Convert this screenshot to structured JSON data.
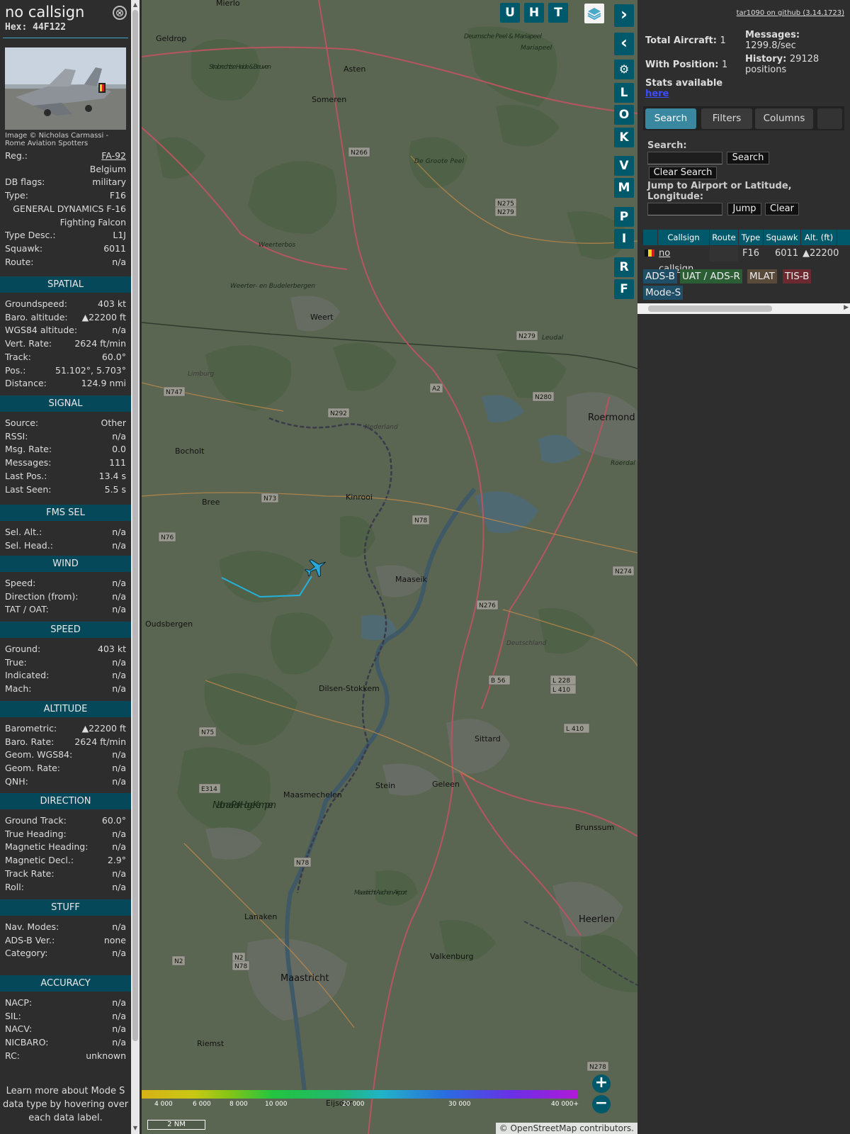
{
  "aircraft": {
    "callsign": "no callsign",
    "hex_label": "Hex:",
    "hex": "44F122",
    "close_glyph": "⊗",
    "photo_credit": "Image © Nicholas Carmassi - Rome Aviation Spotters",
    "header_rows": [
      {
        "label": "Reg.:",
        "value": "FA-92"
      },
      {
        "label": "",
        "value": "Belgium"
      },
      {
        "label": "DB flags:",
        "value": "military"
      },
      {
        "label": "Type:",
        "value": "F16"
      },
      {
        "label": "",
        "value": "GENERAL DYNAMICS F-16"
      },
      {
        "label": "",
        "value": "Fighting Falcon"
      },
      {
        "label": "Type Desc.:",
        "value": "L1J"
      },
      {
        "label": "Squawk:",
        "value": "6011"
      },
      {
        "label": "Route:",
        "value": "n/a"
      }
    ]
  },
  "sections": {
    "spatial": {
      "title": "SPATIAL",
      "rows": [
        {
          "label": "Groundspeed:",
          "value": "403 kt"
        },
        {
          "label": "Baro. altitude:",
          "value": "▲22200 ft"
        },
        {
          "label": "WGS84 altitude:",
          "value": "n/a"
        },
        {
          "label": "Vert. Rate:",
          "value": "2624 ft/min"
        },
        {
          "label": "Track:",
          "value": "60.0°"
        },
        {
          "label": "Pos.:",
          "value": "51.102°, 5.703°"
        },
        {
          "label": "Distance:",
          "value": "124.9 nmi"
        }
      ]
    },
    "signal": {
      "title": "SIGNAL",
      "rows": [
        {
          "label": "Source:",
          "value": "Other"
        },
        {
          "label": "RSSI:",
          "value": "n/a"
        },
        {
          "label": "Msg. Rate:",
          "value": "0.0"
        },
        {
          "label": "Messages:",
          "value": "111"
        },
        {
          "label": "Last Pos.:",
          "value": "13.4 s"
        },
        {
          "label": "Last Seen:",
          "value": "5.5 s"
        }
      ]
    },
    "fms": {
      "title": "FMS SEL",
      "rows": [
        {
          "label": "Sel. Alt.:",
          "value": "n/a"
        },
        {
          "label": "Sel. Head.:",
          "value": "n/a"
        }
      ]
    },
    "wind": {
      "title": "WIND",
      "rows": [
        {
          "label": "Speed:",
          "value": "n/a"
        },
        {
          "label": "Direction (from):",
          "value": "n/a"
        },
        {
          "label": "TAT / OAT:",
          "value": "n/a"
        }
      ]
    },
    "speed": {
      "title": "SPEED",
      "rows": [
        {
          "label": "Ground:",
          "value": "403 kt"
        },
        {
          "label": "True:",
          "value": "n/a"
        },
        {
          "label": "Indicated:",
          "value": "n/a"
        },
        {
          "label": "Mach:",
          "value": "n/a"
        }
      ]
    },
    "altitude": {
      "title": "ALTITUDE",
      "rows": [
        {
          "label": "Barometric:",
          "value": "▲22200 ft"
        },
        {
          "label": "Baro. Rate:",
          "value": "2624 ft/min"
        },
        {
          "label": "Geom. WGS84:",
          "value": "n/a"
        },
        {
          "label": "Geom. Rate:",
          "value": "n/a"
        },
        {
          "label": "QNH:",
          "value": "n/a"
        }
      ]
    },
    "direction": {
      "title": "DIRECTION",
      "rows": [
        {
          "label": "Ground Track:",
          "value": "60.0°"
        },
        {
          "label": "True Heading:",
          "value": "n/a"
        },
        {
          "label": "Magnetic Heading:",
          "value": "n/a"
        },
        {
          "label": "Magnetic Decl.:",
          "value": "2.9°"
        },
        {
          "label": "Track Rate:",
          "value": "n/a"
        },
        {
          "label": "Roll:",
          "value": "n/a"
        }
      ]
    },
    "stuff": {
      "title": "STUFF",
      "rows": [
        {
          "label": "Nav. Modes:",
          "value": "n/a"
        },
        {
          "label": "ADS-B Ver.:",
          "value": "none"
        },
        {
          "label": "Category:",
          "value": "n/a"
        }
      ]
    },
    "accuracy": {
      "title": "ACCURACY",
      "rows": [
        {
          "label": "NACP:",
          "value": "n/a"
        },
        {
          "label": "SIL:",
          "value": "n/a"
        },
        {
          "label": "NACV:",
          "value": "n/a"
        },
        {
          "label": "NICBARO:",
          "value": "n/a"
        },
        {
          "label": "RC:",
          "value": "unknown"
        }
      ]
    }
  },
  "info_note": "Learn more about Mode S data type by hovering over each data label.",
  "map": {
    "top_buttons": [
      "U",
      "H",
      "T"
    ],
    "side_buttons": [
      "L",
      "O",
      "K",
      "V",
      "M",
      "P",
      "I",
      "R",
      "F"
    ],
    "layers_icon": "layers-icon",
    "color_legend": [
      "4 000",
      "6 000",
      "8 000",
      "10 000",
      "20 000",
      "30 000",
      "40 000+"
    ],
    "scale": "2 NM",
    "attribution": "© OpenStreetMap contributors.",
    "zoom_in": "+",
    "zoom_out": "−",
    "places": [
      {
        "name": "Mierlo"
      },
      {
        "name": "Geldrop"
      },
      {
        "name": "Strabrechtse Heide & Beuven"
      },
      {
        "name": "Asten"
      },
      {
        "name": "Someren"
      },
      {
        "name": "Deurnsche Peel & Mariapeel"
      },
      {
        "name": "Mariapeel"
      },
      {
        "name": "De Groote Peel"
      },
      {
        "name": "Weerterbos"
      },
      {
        "name": "Weerter- en Budelerbergen"
      },
      {
        "name": "Weert"
      },
      {
        "name": "Leudal"
      },
      {
        "name": "Roermond"
      },
      {
        "name": "Roerdal"
      },
      {
        "name": "Bocholt"
      },
      {
        "name": "Bree"
      },
      {
        "name": "Kinrooi"
      },
      {
        "name": "Maaseik"
      },
      {
        "name": "Oudsbergen"
      },
      {
        "name": "Dilsen-Stokkem"
      },
      {
        "name": "Sittard"
      },
      {
        "name": "Maasmechelen"
      },
      {
        "name": "Stein"
      },
      {
        "name": "Geleen"
      },
      {
        "name": "Brunssum"
      },
      {
        "name": "Nationaal Park Hoge Kempen"
      },
      {
        "name": "Maastricht Aachen Airport"
      },
      {
        "name": "Lanaken"
      },
      {
        "name": "Heerlen"
      },
      {
        "name": "Valkenburg"
      },
      {
        "name": "Maastricht"
      },
      {
        "name": "Riemst"
      },
      {
        "name": "Limburg"
      },
      {
        "name": "Nederland"
      },
      {
        "name": "Deutschland"
      },
      {
        "name": "Eijsden"
      }
    ],
    "roads": [
      "N266",
      "N275",
      "N279",
      "N279",
      "N747",
      "N292",
      "A2",
      "N280",
      "N73",
      "N78",
      "N76",
      "N274",
      "N276",
      "B 56",
      "L 228",
      "L 410",
      "L 410",
      "N75",
      "E314",
      "N78",
      "N2",
      "N2",
      "N78",
      "N278"
    ]
  },
  "right_panel": {
    "github_link": "tar1090 on github (3.14.1723)",
    "total_aircraft_label": "Total Aircraft:",
    "total_aircraft": "1",
    "with_position_label": "With Position:",
    "with_position": "1",
    "messages_label": "Messages:",
    "messages_rate": "1299.8/sec",
    "history_label": "History:",
    "history_value": "29128",
    "history_unit": "positions",
    "stats_label": "Stats available",
    "stats_link": "here",
    "tabs": [
      "Search",
      "Filters",
      "Columns"
    ],
    "search_label": "Search:",
    "search_button": "Search",
    "clear_search_button": "Clear Search",
    "jump_label": "Jump to Airport or Latitude, Longitude:",
    "jump_button": "Jump",
    "clear_button": "Clear",
    "table_headers": [
      "Callsign",
      "Route",
      "Type",
      "Squawk",
      "Alt. (ft)"
    ],
    "table_rows": [
      {
        "callsign": "no callsign",
        "route": "",
        "type": "F16",
        "squawk": "6011",
        "alt": "▲22200"
      }
    ],
    "source_badges": [
      {
        "label": "ADS-B",
        "color": "#1f4f66"
      },
      {
        "label": "UAT / ADS-R",
        "color": "#2c5e35"
      },
      {
        "label": "MLAT",
        "color": "#5a4a3a"
      },
      {
        "label": "TIS-B",
        "color": "#6a2a30"
      },
      {
        "label": "Mode-S",
        "color": "#1f4f66"
      }
    ]
  },
  "colors": {
    "section_header": "#05485a",
    "button": "#00596b",
    "track_line": "#23b2dc",
    "aircraft_icon": "#2ba7d5"
  }
}
